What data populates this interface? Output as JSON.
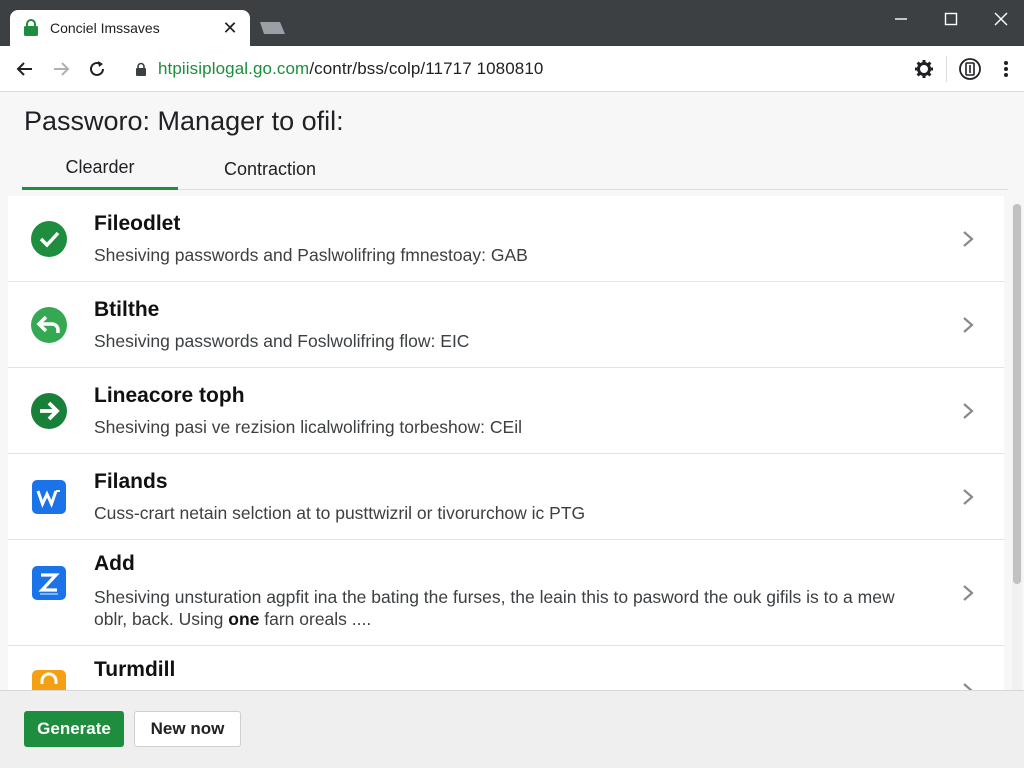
{
  "browser": {
    "tab_title": "Conciel Imssaves",
    "url_host": "htpiisiplogal.go.com",
    "url_path": "/contr/bss/colp/11717 1080810"
  },
  "page": {
    "title": "Passworo: Manager to ofil:",
    "tabs": [
      {
        "label": "Clearder",
        "active": true
      },
      {
        "label": "Contraction",
        "active": false
      }
    ]
  },
  "items": [
    {
      "title": "Fileodlet",
      "description": "Shesiving passwords and Paslwolifring fmnestoay: GAB",
      "icon": "check-circle-icon",
      "color": "#1e8e3e"
    },
    {
      "title": "Btilthe",
      "description": "Shesiving passwords and Foslwolifring flow: EIC",
      "icon": "reply-arrow-icon",
      "color": "#34a853"
    },
    {
      "title": "Lineacore toph",
      "description": "Shesiving pasi ve rezision licalwolifring torbeshow: CEil",
      "icon": "arrow-right-circle-icon",
      "color": "#188038"
    },
    {
      "title": "Filands",
      "description": "Cuss-crart netain selction at to pusttwizril or tivorurchow ic PTG",
      "icon": "w-app-icon",
      "color": "#1a73e8"
    },
    {
      "title": "Add",
      "description": "Shesiving unsturation agpfit ina the bating the furses, the leain this to pasword the ouk gifils is to a mew oblr, back. Using",
      "description_bold": "one",
      "description_tail": "farn oreals ....",
      "icon": "z-app-icon",
      "color": "#1a73e8"
    },
    {
      "title": "Turmdill",
      "description": "",
      "icon": "lock-app-icon",
      "color": "#f4a015"
    }
  ],
  "footer": {
    "generate_label": "Generate",
    "new_label": "New now"
  },
  "colors": {
    "accent": "#1e8e3e",
    "chrome": "#3c4043"
  }
}
